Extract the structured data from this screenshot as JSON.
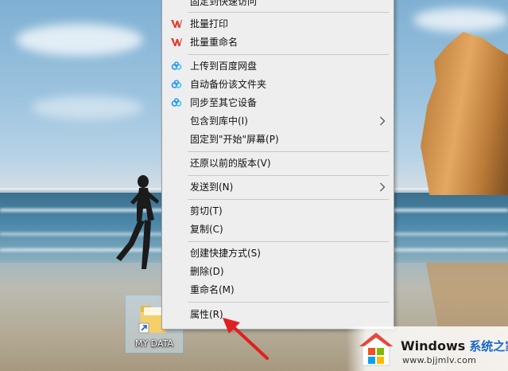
{
  "desktop": {
    "icon_label": "MY DATA"
  },
  "context_menu": {
    "items": [
      {
        "label": "固定到快速访问",
        "icon": ""
      },
      {
        "label": "批量打印",
        "icon": "wps-icon"
      },
      {
        "label": "批量重命名",
        "icon": "wps-icon"
      },
      {
        "label": "上传到百度网盘",
        "icon": "baidu-netdisk-icon"
      },
      {
        "label": "自动备份该文件夹",
        "icon": "baidu-netdisk-icon"
      },
      {
        "label": "同步至其它设备",
        "icon": "baidu-netdisk-icon"
      },
      {
        "label": "包含到库中(I)",
        "icon": "",
        "submenu": true
      },
      {
        "label": "固定到\"开始\"屏幕(P)",
        "icon": ""
      },
      {
        "label": "还原以前的版本(V)",
        "icon": ""
      },
      {
        "label": "发送到(N)",
        "icon": "",
        "submenu": true
      },
      {
        "label": "剪切(T)",
        "icon": ""
      },
      {
        "label": "复制(C)",
        "icon": ""
      },
      {
        "label": "创建快捷方式(S)",
        "icon": ""
      },
      {
        "label": "删除(D)",
        "icon": ""
      },
      {
        "label": "重命名(M)",
        "icon": ""
      },
      {
        "label": "属性(R)",
        "icon": ""
      }
    ]
  },
  "watermark": {
    "title": "Windows",
    "title_cn": "系统之家",
    "url": "www.bjjmlv.com"
  },
  "colors": {
    "menu_background": "#eeeeee",
    "separator": "#c8c8c8",
    "wps_red": "#e33b2e",
    "baidu_blue": "#2f8cf0",
    "arrow_red": "#e02020",
    "watermark_blue": "#1b67c9"
  }
}
